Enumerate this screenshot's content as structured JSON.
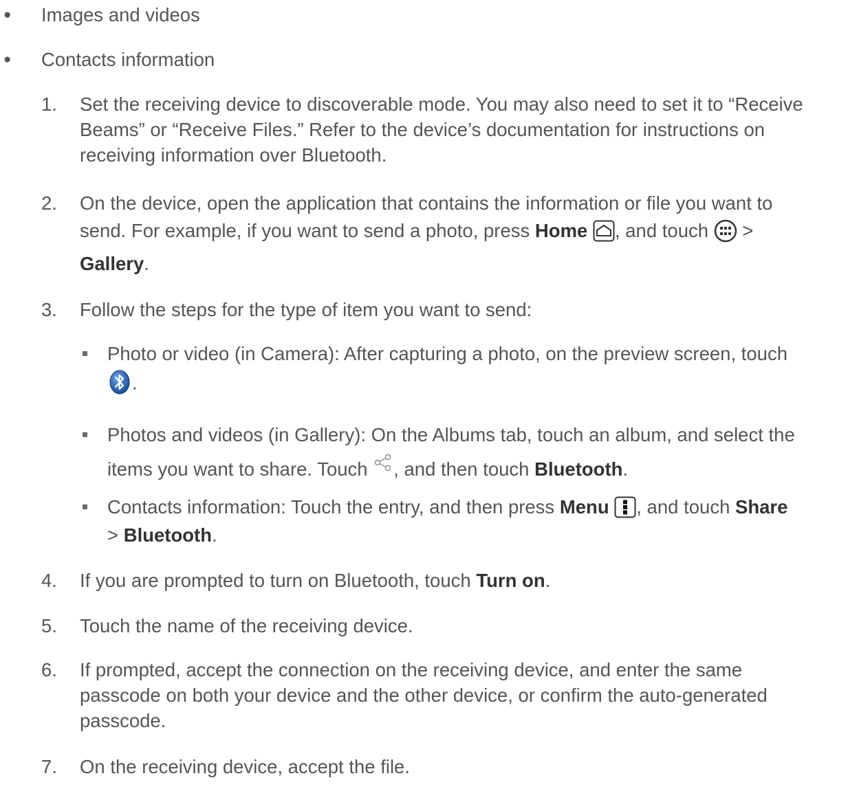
{
  "bullets": [
    "Images and videos",
    "Contacts information"
  ],
  "steps": {
    "s1": {
      "num": "1.",
      "l1": "Set the receiving device to discoverable mode. You may also need to set it to “Receive",
      "l2": "Beams” or “Receive Files.” Refer to the device’s documentation for instructions on",
      "l3": "receiving information over Bluetooth."
    },
    "s2": {
      "num": "2.",
      "l1": "On the device, open the application that contains the information or file you want to",
      "l2a": "send. For example, if you want to send a photo, press ",
      "home": "Home",
      "l2b": ", and touch ",
      "l2c": " >",
      "gallery": "Gallery",
      "period": "."
    },
    "s3": {
      "num": "3.",
      "l1": "Follow the steps for the type of item you want to send:",
      "sub": {
        "a": {
          "l1": "Photo or video (in Camera): After capturing a photo, on the preview screen, touch",
          "l2": "."
        },
        "b": {
          "l1": "Photos and videos (in Gallery): On the Albums tab, touch an album, and select the",
          "l2a": "items you want to share. Touch ",
          "l2b": ", and then touch ",
          "bt": "Bluetooth",
          "l2c": "."
        },
        "c": {
          "l1a": "Contacts information: Touch the entry, and then press ",
          "menu": "Menu",
          "l1b": ", and touch ",
          "share": "Share",
          "l2a": "> ",
          "bt": "Bluetooth",
          "l2b": "."
        }
      }
    },
    "s4": {
      "num": "4.",
      "a": "If you are prompted to turn on Bluetooth, touch ",
      "turnon": "Turn on",
      "b": "."
    },
    "s5": {
      "num": "5.",
      "text": "Touch the name of the receiving device."
    },
    "s6": {
      "num": "6.",
      "l1": "If prompted, accept the connection on the receiving device, and enter the same",
      "l2": "passcode on both your device and the other device, or confirm the auto-generated",
      "l3": "passcode."
    },
    "s7": {
      "num": "7.",
      "text": "On the receiving device, accept the file."
    }
  },
  "icons": {
    "home": "home-icon",
    "apps": "apps-icon",
    "bluetooth": "bluetooth-icon",
    "share": "share-icon",
    "menu": "menu-icon"
  }
}
